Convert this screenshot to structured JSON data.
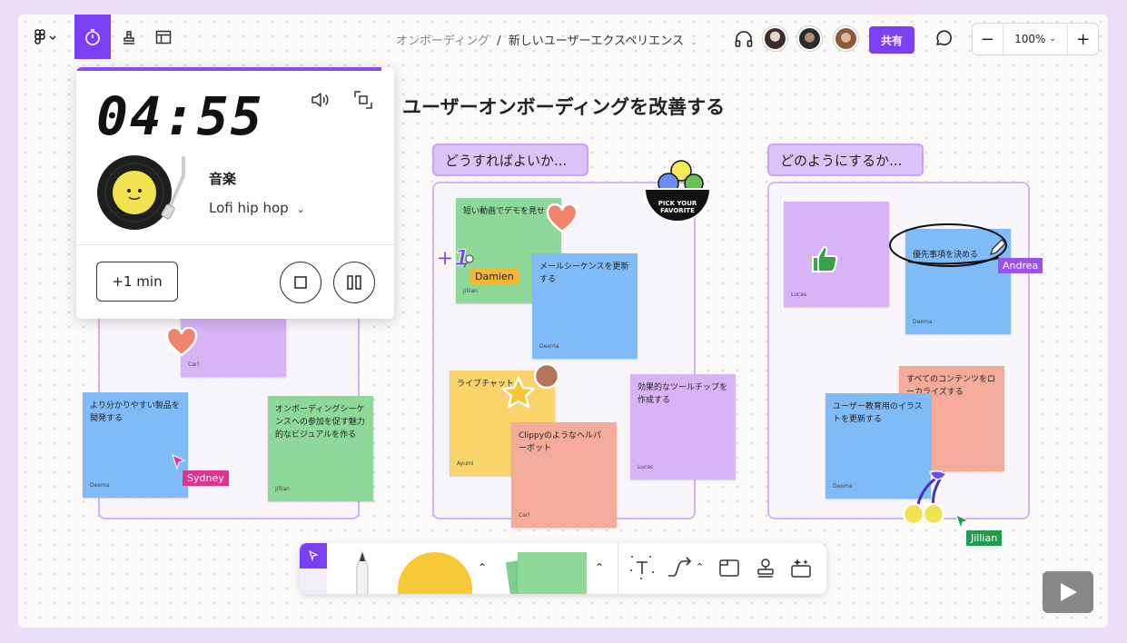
{
  "breadcrumb": {
    "project": "オンボーディング",
    "separator": "/",
    "file": "新しいユーザーエクスペリエンス"
  },
  "share_label": "共有",
  "zoom": {
    "minus": "−",
    "level": "100%",
    "plus": "+"
  },
  "board_title": "ユーザーオンボーディングを改善する",
  "sections": [
    {
      "label": "どうすればよいか..."
    },
    {
      "label": "どのようにするか..."
    }
  ],
  "stickies": {
    "s1": {
      "text": "",
      "author": "Carl"
    },
    "s2": {
      "text": "より分かりやすい製品を開発する",
      "author": "Deema"
    },
    "s3": {
      "text": "オンボーディングシーケンスへの参加を促す魅力的なビジュアルを作る",
      "author": "Jillian"
    },
    "s4": {
      "text": "短い動画でデモを見せる",
      "author": "Jillian"
    },
    "s5": {
      "text": "メールシーケンスを更新する",
      "author": "Deema"
    },
    "s6": {
      "text": "ライブチャット",
      "author": "Ayumi"
    },
    "s7": {
      "text": "Clippyのようなヘルパーボット",
      "author": "Carl"
    },
    "s8": {
      "text": "効果的なツールチップを作成する",
      "author": "Lucas"
    },
    "s9": {
      "text": "",
      "author": "Lucas"
    },
    "s10": {
      "text": "優先事項を決める",
      "author": "Deema"
    },
    "s11": {
      "text": "すべてのコンテンツをローカライズする",
      "author": ""
    },
    "s12": {
      "text": "ユーザー教育用のイラストを更新する",
      "author": "Deema"
    }
  },
  "cursors": {
    "sydney": "Sydney",
    "damien": "Damien",
    "andrea": "Andrea",
    "jillian": "Jillian"
  },
  "sticker_text": {
    "pick": "PICK YOUR FAVORITE",
    "plus_one": "+1"
  },
  "timer": {
    "time": "04:55",
    "progress": 0.96,
    "music_label": "音楽",
    "track": "Lofi hip hop",
    "add_min": "+1 min"
  },
  "colors": {
    "accent": "#7b3ff2",
    "sydney": "#e0338f",
    "damien": "#f5b731",
    "andrea": "#9c50ee",
    "jillian": "#1f9d4d"
  }
}
